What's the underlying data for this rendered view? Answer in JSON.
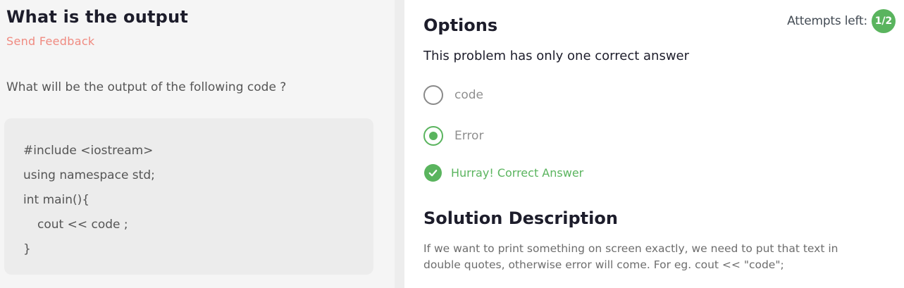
{
  "question": {
    "title": "What is the output",
    "feedback_link": "Send Feedback",
    "text": "What will be the output of the following code ?",
    "code_lines": [
      "#include <iostream>",
      "using namespace std;",
      "int main(){",
      "cout << code ;",
      "}"
    ]
  },
  "options_panel": {
    "title": "Options",
    "attempts_label": "Attempts left:",
    "attempts_value": "1/2",
    "instruction": "This problem has only one correct answer",
    "options": [
      {
        "label": "code",
        "selected": false
      },
      {
        "label": "Error",
        "selected": true
      }
    ],
    "result_text": "Hurray! Correct Answer",
    "solution_title": "Solution Description",
    "solution_text": "If we want to print something on screen exactly, we need to put that text in double quotes, otherwise error will come. For eg. cout << \"code\";"
  },
  "colors": {
    "accent_green": "#5ab45e",
    "feedback_red": "#f08a80",
    "heading": "#1d1d2b"
  },
  "icons": {
    "check": "check-circle-icon"
  }
}
